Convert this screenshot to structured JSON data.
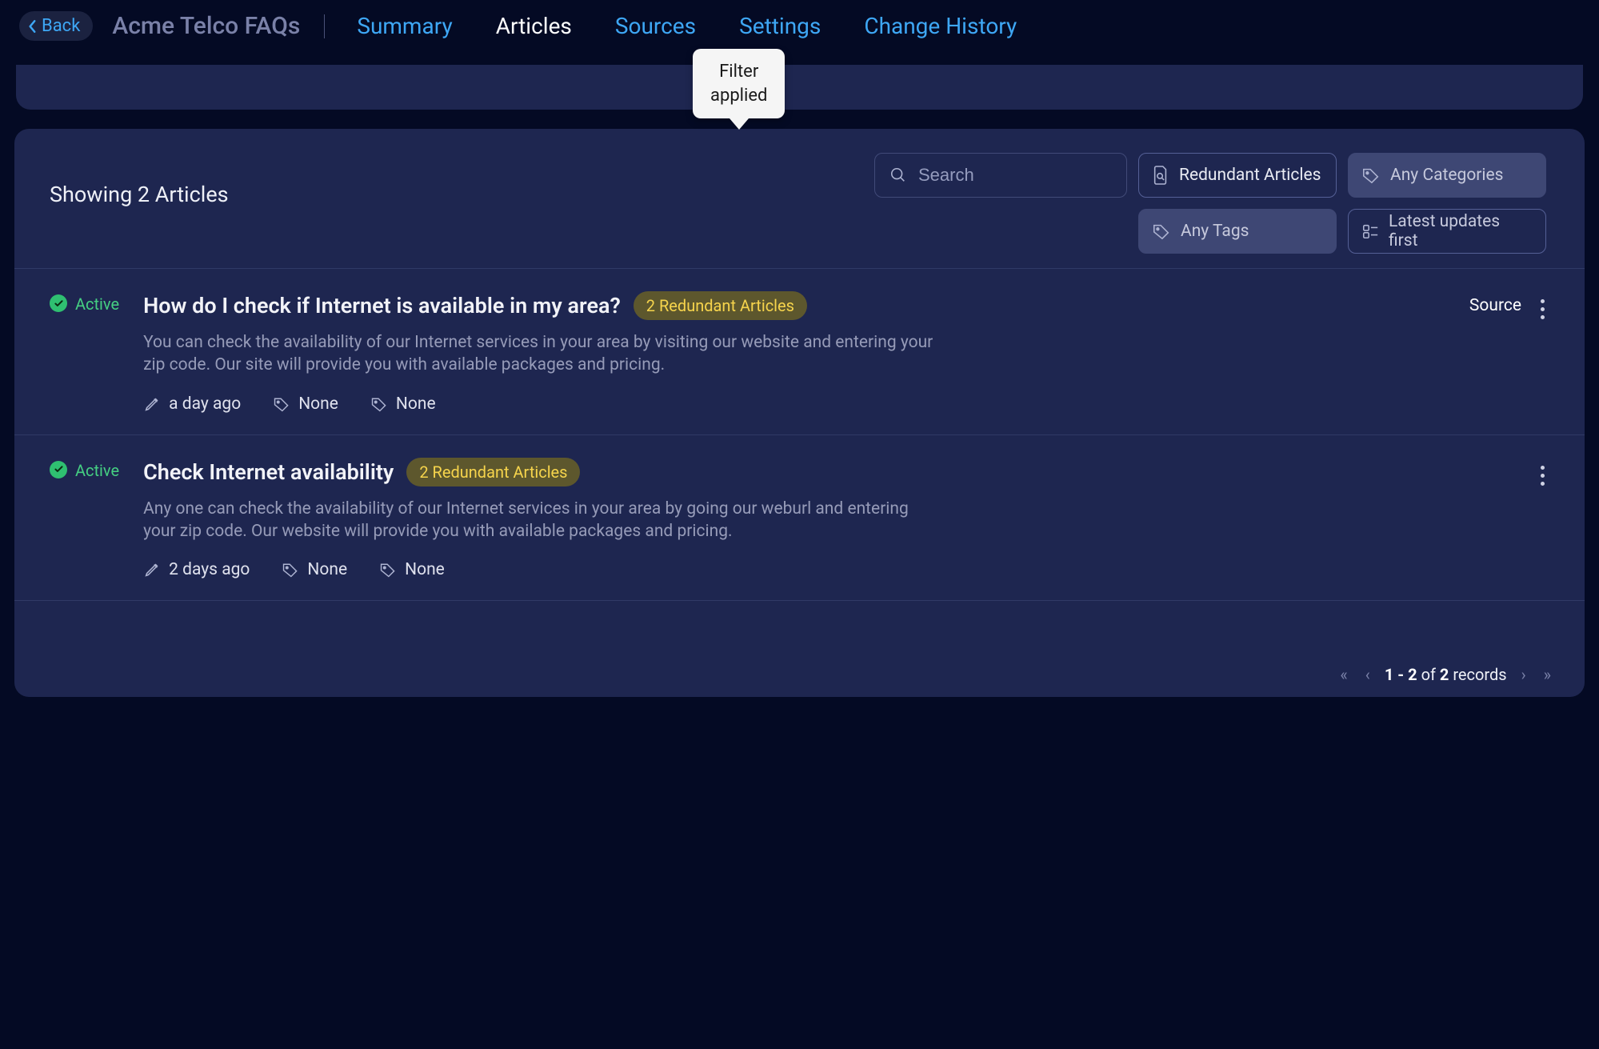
{
  "header": {
    "back_label": "Back",
    "title": "Acme Telco FAQs",
    "tabs": [
      {
        "label": "Summary",
        "active": false
      },
      {
        "label": "Articles",
        "active": true
      },
      {
        "label": "Sources",
        "active": false
      },
      {
        "label": "Settings",
        "active": false
      },
      {
        "label": "Change History",
        "active": false
      }
    ]
  },
  "tooltip": {
    "line1": "Filter",
    "line2": "applied"
  },
  "toolbar": {
    "showing": "Showing 2 Articles",
    "search_placeholder": "Search",
    "filters": {
      "redundant": "Redundant Articles",
      "categories": "Any Categories",
      "tags": "Any Tags",
      "sort": "Latest updates first"
    }
  },
  "articles": [
    {
      "status": "Active",
      "title": "How do I check if Internet is available in my area?",
      "badge": "2 Redundant Articles",
      "description": "You can check the availability of our Internet services in your area by visiting our website and entering your zip code. Our site will provide you with available packages and pricing.",
      "edited": "a day ago",
      "category": "None",
      "tag": "None",
      "source_label": "Source"
    },
    {
      "status": "Active",
      "title": "Check Internet availability",
      "badge": "2 Redundant Articles",
      "description": "Any one can check the availability of our Internet services in your area by going our weburl and entering your zip code. Our website will provide you with available packages and pricing.",
      "edited": "2 days ago",
      "category": "None",
      "tag": "None",
      "source_label": ""
    }
  ],
  "pagination": {
    "range": "1 - 2",
    "of_word": "of",
    "total": "2",
    "records_word": "records"
  }
}
